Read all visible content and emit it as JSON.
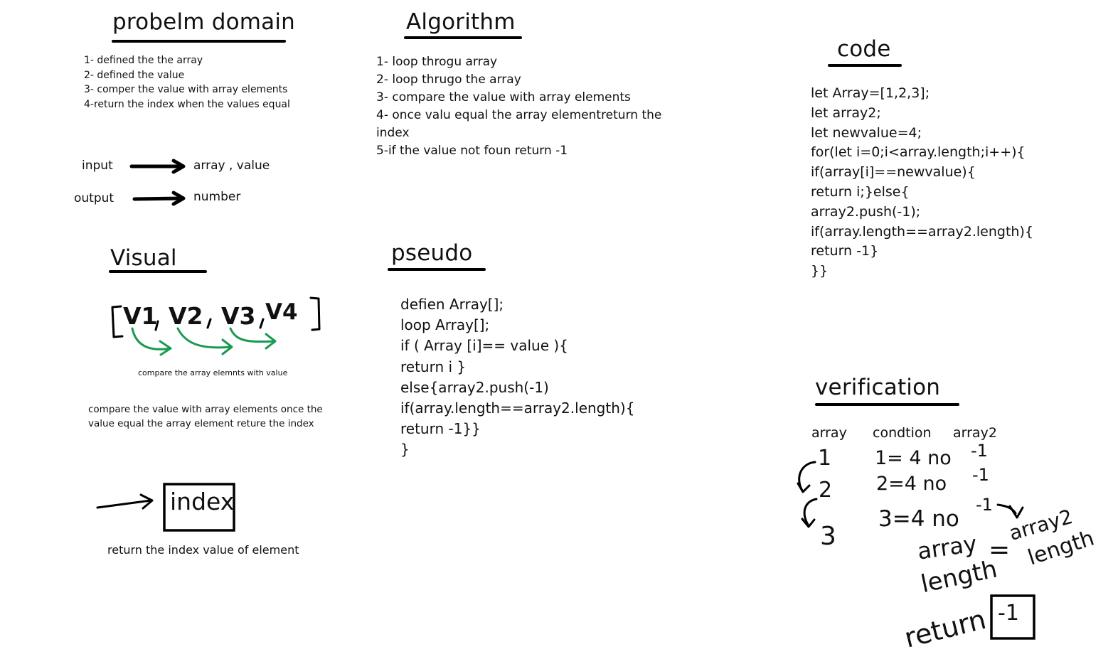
{
  "problem_domain": {
    "title": "probelm domain",
    "items": [
      "1- defined the the array",
      "2- defined the value",
      "3- comper the value with array elements",
      "4-return the index when the values equal"
    ]
  },
  "io": {
    "input_label": "input",
    "input_value": "array  ,  value",
    "output_label": "output",
    "output_value": "number"
  },
  "algorithm": {
    "title": "Algorithm",
    "items": [
      "1- loop throgu array",
      "2- loop thrugo the array",
      "3- compare the value with array elements",
      "4- once valu equal the array elementreturn the",
      "index",
      "5-if the value not foun return -1"
    ]
  },
  "code": {
    "title": "code",
    "lines": [
      "let Array=[1,2,3];",
      "let array2;",
      "let newvalue=4;",
      "for(let i=0;i<array.length;i++){",
      "if(array[i]==newvalue){",
      "return i;}else{",
      "array2.push(-1);",
      "if(array.length==array2.length){",
      "return -1}",
      "}}"
    ]
  },
  "visual": {
    "title": "Visual",
    "array_caption": "compare the array elemnts with value",
    "elements": [
      "V1",
      "V2",
      "V3",
      "V4"
    ],
    "description": [
      "compare the  value with array elements once the",
      "value equal the array element reture the index"
    ],
    "index_box": "index",
    "index_caption": "return the index value of element",
    "arrow_color": "#1a9a4f"
  },
  "pseudo": {
    "title": "pseudo",
    "lines": [
      "defien Array[];",
      "loop Array[];",
      "if ( Array [i]== value ){",
      "return i }",
      "else{array2.push(-1)",
      "if(array.length==array2.length){",
      "return -1}}",
      "}"
    ]
  },
  "verification": {
    "title": "verification",
    "headers": [
      "array",
      "condtion",
      "array2"
    ],
    "rows": [
      {
        "array": "1",
        "condition": "1= 4 no",
        "array2": "-1"
      },
      {
        "array": "2",
        "condition": "2=4 no",
        "array2": "-1"
      },
      {
        "array": "3",
        "condition": "3=4 no",
        "array2": "-1"
      }
    ],
    "left_term": [
      "array",
      "length"
    ],
    "equals": "=",
    "right_term": [
      "array2",
      "length"
    ],
    "return_label": "return",
    "return_value": "-1"
  }
}
